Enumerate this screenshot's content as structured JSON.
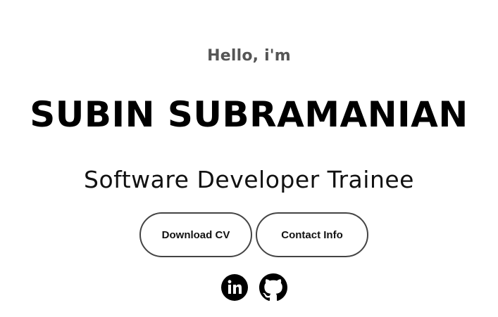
{
  "hero": {
    "greeting": "Hello, i'm",
    "name": "SUBIN SUBRAMANIAN",
    "role": "Software Developer Trainee"
  },
  "buttons": {
    "download_cv": "Download CV",
    "contact_info": "Contact Info"
  },
  "socials": [
    {
      "icon": "linkedin-icon"
    },
    {
      "icon": "github-icon"
    }
  ],
  "colors": {
    "text": "#000000",
    "greeting": "#555555",
    "button_border": "#444444",
    "background": "#ffffff"
  }
}
